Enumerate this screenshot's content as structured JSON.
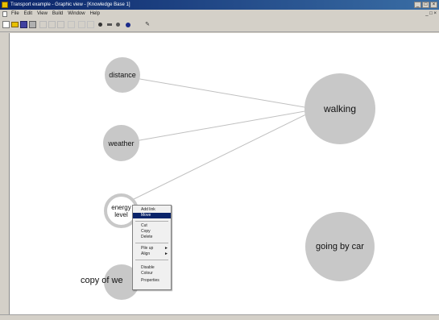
{
  "window": {
    "title": "Transport example - Graphic view - [Knowledge Base 1]",
    "controls": [
      "_",
      "□",
      "×"
    ]
  },
  "menubar": {
    "items": [
      "File",
      "Edit",
      "View",
      "Build",
      "Window",
      "Help"
    ],
    "doc_controls": "_ □ ×"
  },
  "toolbar": {
    "icons": [
      "new-icon",
      "open-icon",
      "save-icon",
      "print-icon",
      "cut-icon",
      "copy-icon",
      "paste-icon",
      "undo-icon",
      "zoom-icon",
      "link-icon",
      "node-icon",
      "arrow-icon",
      "dot-icon",
      "help-icon"
    ]
  },
  "nodes": [
    {
      "id": "distance",
      "label": "distance"
    },
    {
      "id": "weather",
      "label": "weather"
    },
    {
      "id": "energy",
      "label_line1": "energy",
      "label_line2": "level"
    },
    {
      "id": "copy",
      "label": "copy of we"
    },
    {
      "id": "walking",
      "label": "walking"
    },
    {
      "id": "car",
      "label": "going by car"
    }
  ],
  "edges": [
    {
      "from": "distance",
      "to": "walking"
    },
    {
      "from": "weather",
      "to": "walking"
    },
    {
      "from": "energy",
      "to": "walking"
    }
  ],
  "context_menu": {
    "items": [
      {
        "label": "Add link",
        "selected": false
      },
      {
        "label": "Move",
        "selected": true
      },
      {
        "label": "Cut",
        "selected": false
      },
      {
        "label": "Copy",
        "selected": false
      },
      {
        "label": "Delete",
        "selected": false
      },
      {
        "label": "Pile up",
        "selected": false,
        "submenu": true
      },
      {
        "label": "Align",
        "selected": false,
        "submenu": true
      },
      {
        "label": "Disable",
        "selected": false
      },
      {
        "label": "Colour",
        "selected": false
      },
      {
        "label": "Properties",
        "selected": false
      }
    ]
  },
  "colors": {
    "titlebar": "#0a246a",
    "node_fill": "#c8c8c8",
    "edge": "#c0c0c0",
    "selection": "#0a246a"
  }
}
